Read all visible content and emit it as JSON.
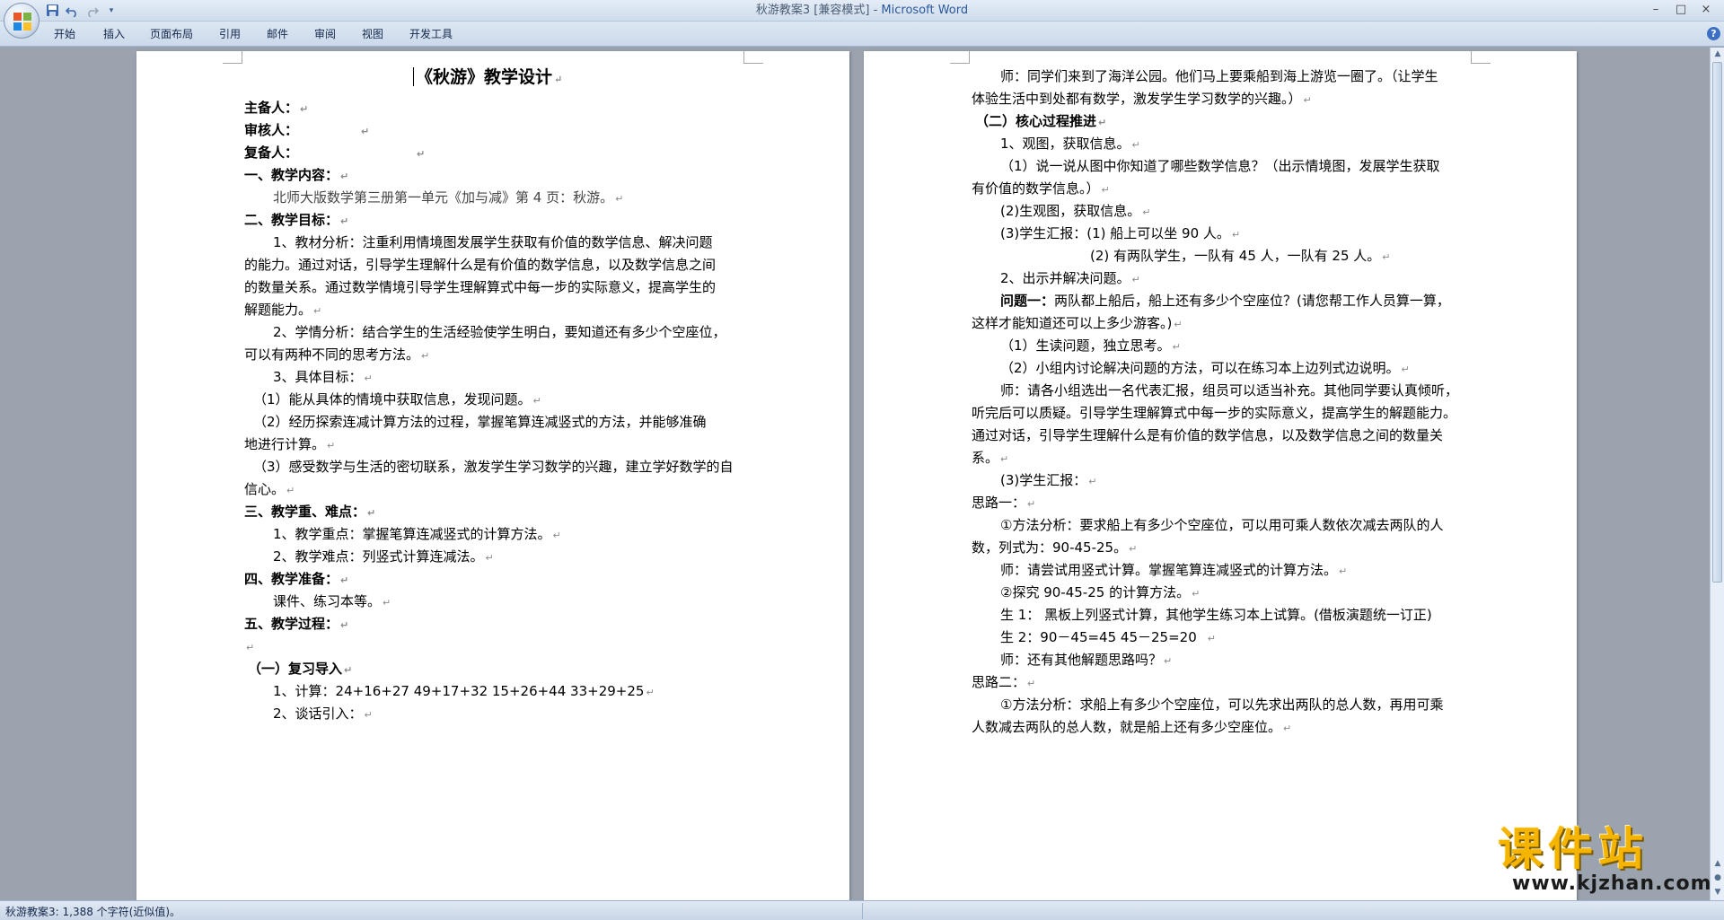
{
  "window": {
    "title_doc": "秋游教案3 [兼容模式]",
    "title_sep": " - ",
    "title_app": "Microsoft Word"
  },
  "qat": {
    "save_icon": "save-icon",
    "undo_icon": "undo-icon",
    "redo_icon": "redo-icon",
    "customize_icon": "chevron-down-icon"
  },
  "window_controls": {
    "minimize": "–",
    "maximize": "□",
    "close": "×"
  },
  "ribbon": {
    "tabs": [
      "开始",
      "插入",
      "页面布局",
      "引用",
      "邮件",
      "审阅",
      "视图",
      "开发工具"
    ],
    "help": "?"
  },
  "page1": {
    "title": "《秋游》教学设计",
    "lines": [
      "主备人：",
      "审核人：",
      "复备人：",
      "一、教学内容：",
      "北师大版数学第三册第一单元《加与减》第 4 页：秋游。",
      "二、教学目标：",
      "1、教材分析：注重利用情境图发展学生获取有价值的数学信息、解决问题",
      "的能力。通过对话，引导学生理解什么是有价值的数学信息，以及数学信息之间",
      "的数量关系。通过数学情境引导学生理解算式中每一步的实际意义，提高学生的",
      "解题能力。",
      "2、学情分析：结合学生的生活经验使学生明白，要知道还有多少个空座位，",
      "可以有两种不同的思考方法。",
      "3、具体目标：",
      "（1）能从具体的情境中获取信息，发现问题。",
      "（2）经历探索连减计算方法的过程，掌握笔算连减竖式的方法，并能够准确",
      "地进行计算。",
      "（3）感受数学与生活的密切联系，激发学生学习数学的兴趣，建立学好数学的自",
      "信心。",
      "三、教学重、难点：",
      "1、教学重点：掌握笔算连减竖式的计算方法。",
      "2、教学难点：列竖式计算连减法。",
      "四、教学准备：",
      "课件、练习本等。",
      "五、教学过程：",
      "",
      "（一）复习导入",
      "1、计算：24+16+27        49+17+32      15+26+44         33+29+25",
      "2、谈话引入："
    ]
  },
  "page2": {
    "lines": [
      "师：同学们来到了海洋公园。他们马上要乘船到海上游览一圈了。（让学生",
      "体验生活中到处都有数学，激发学生学习数学的兴趣。）",
      "（二）核心过程推进",
      "1、观图，获取信息。",
      "（1）说一说从图中你知道了哪些数学信息？（出示情境图，发展学生获取",
      "有价值的数学信息。）",
      "(2)生观图，获取信息。",
      "(3)学生汇报：(1) 船上可以坐 90 人。",
      "(2) 有两队学生，一队有 45 人，一队有 25 人。",
      "2、出示并解决问题。",
      "问题一：",
      "两队都上船后，船上还有多少个空座位？(请您帮工作人员算一算，",
      "这样才能知道还可以上多少游客。)",
      "（1）生读问题，独立思考。",
      "（2）小组内讨论解决问题的方法，可以在练习本上边列式边说明。",
      "师：请各小组选出一名代表汇报，组员可以适当补充。其他同学要认真倾听，",
      "听完后可以质疑。引导学生理解算式中每一步的实际意义，提高学生的解题能力。",
      "通过对话，引导学生理解什么是有价值的数学信息，以及数学信息之间的数量关",
      "系。",
      "(3)学生汇报：",
      "思路一：",
      "①方法分析：要求船上有多少个空座位，可以用可乘人数依次减去两队的人",
      "数，列式为：90-45-25。",
      "师：请尝试用竖式计算。掌握笔算连减竖式的计算方法。",
      "②探究 90-45-25 的计算方法。",
      "生 1：  黑板上列竖式计算，其他学生练习本上试算。(借板演题统一订正)",
      "生 2：90－45=45          45－25=20",
      "师：还有其他解题思路吗？",
      "思路二：",
      "①方法分析：求船上有多少个空座位，可以先求出两队的总人数，再用可乘",
      "人数减去两队的总人数，就是船上还有多少空座位。"
    ]
  },
  "status": {
    "text": "秋游教案3: 1,388 个字符(近似值)。"
  },
  "watermark": {
    "cn": "课件站",
    "url": "www.kjzhan.com"
  },
  "paragraph_mark": "↵"
}
